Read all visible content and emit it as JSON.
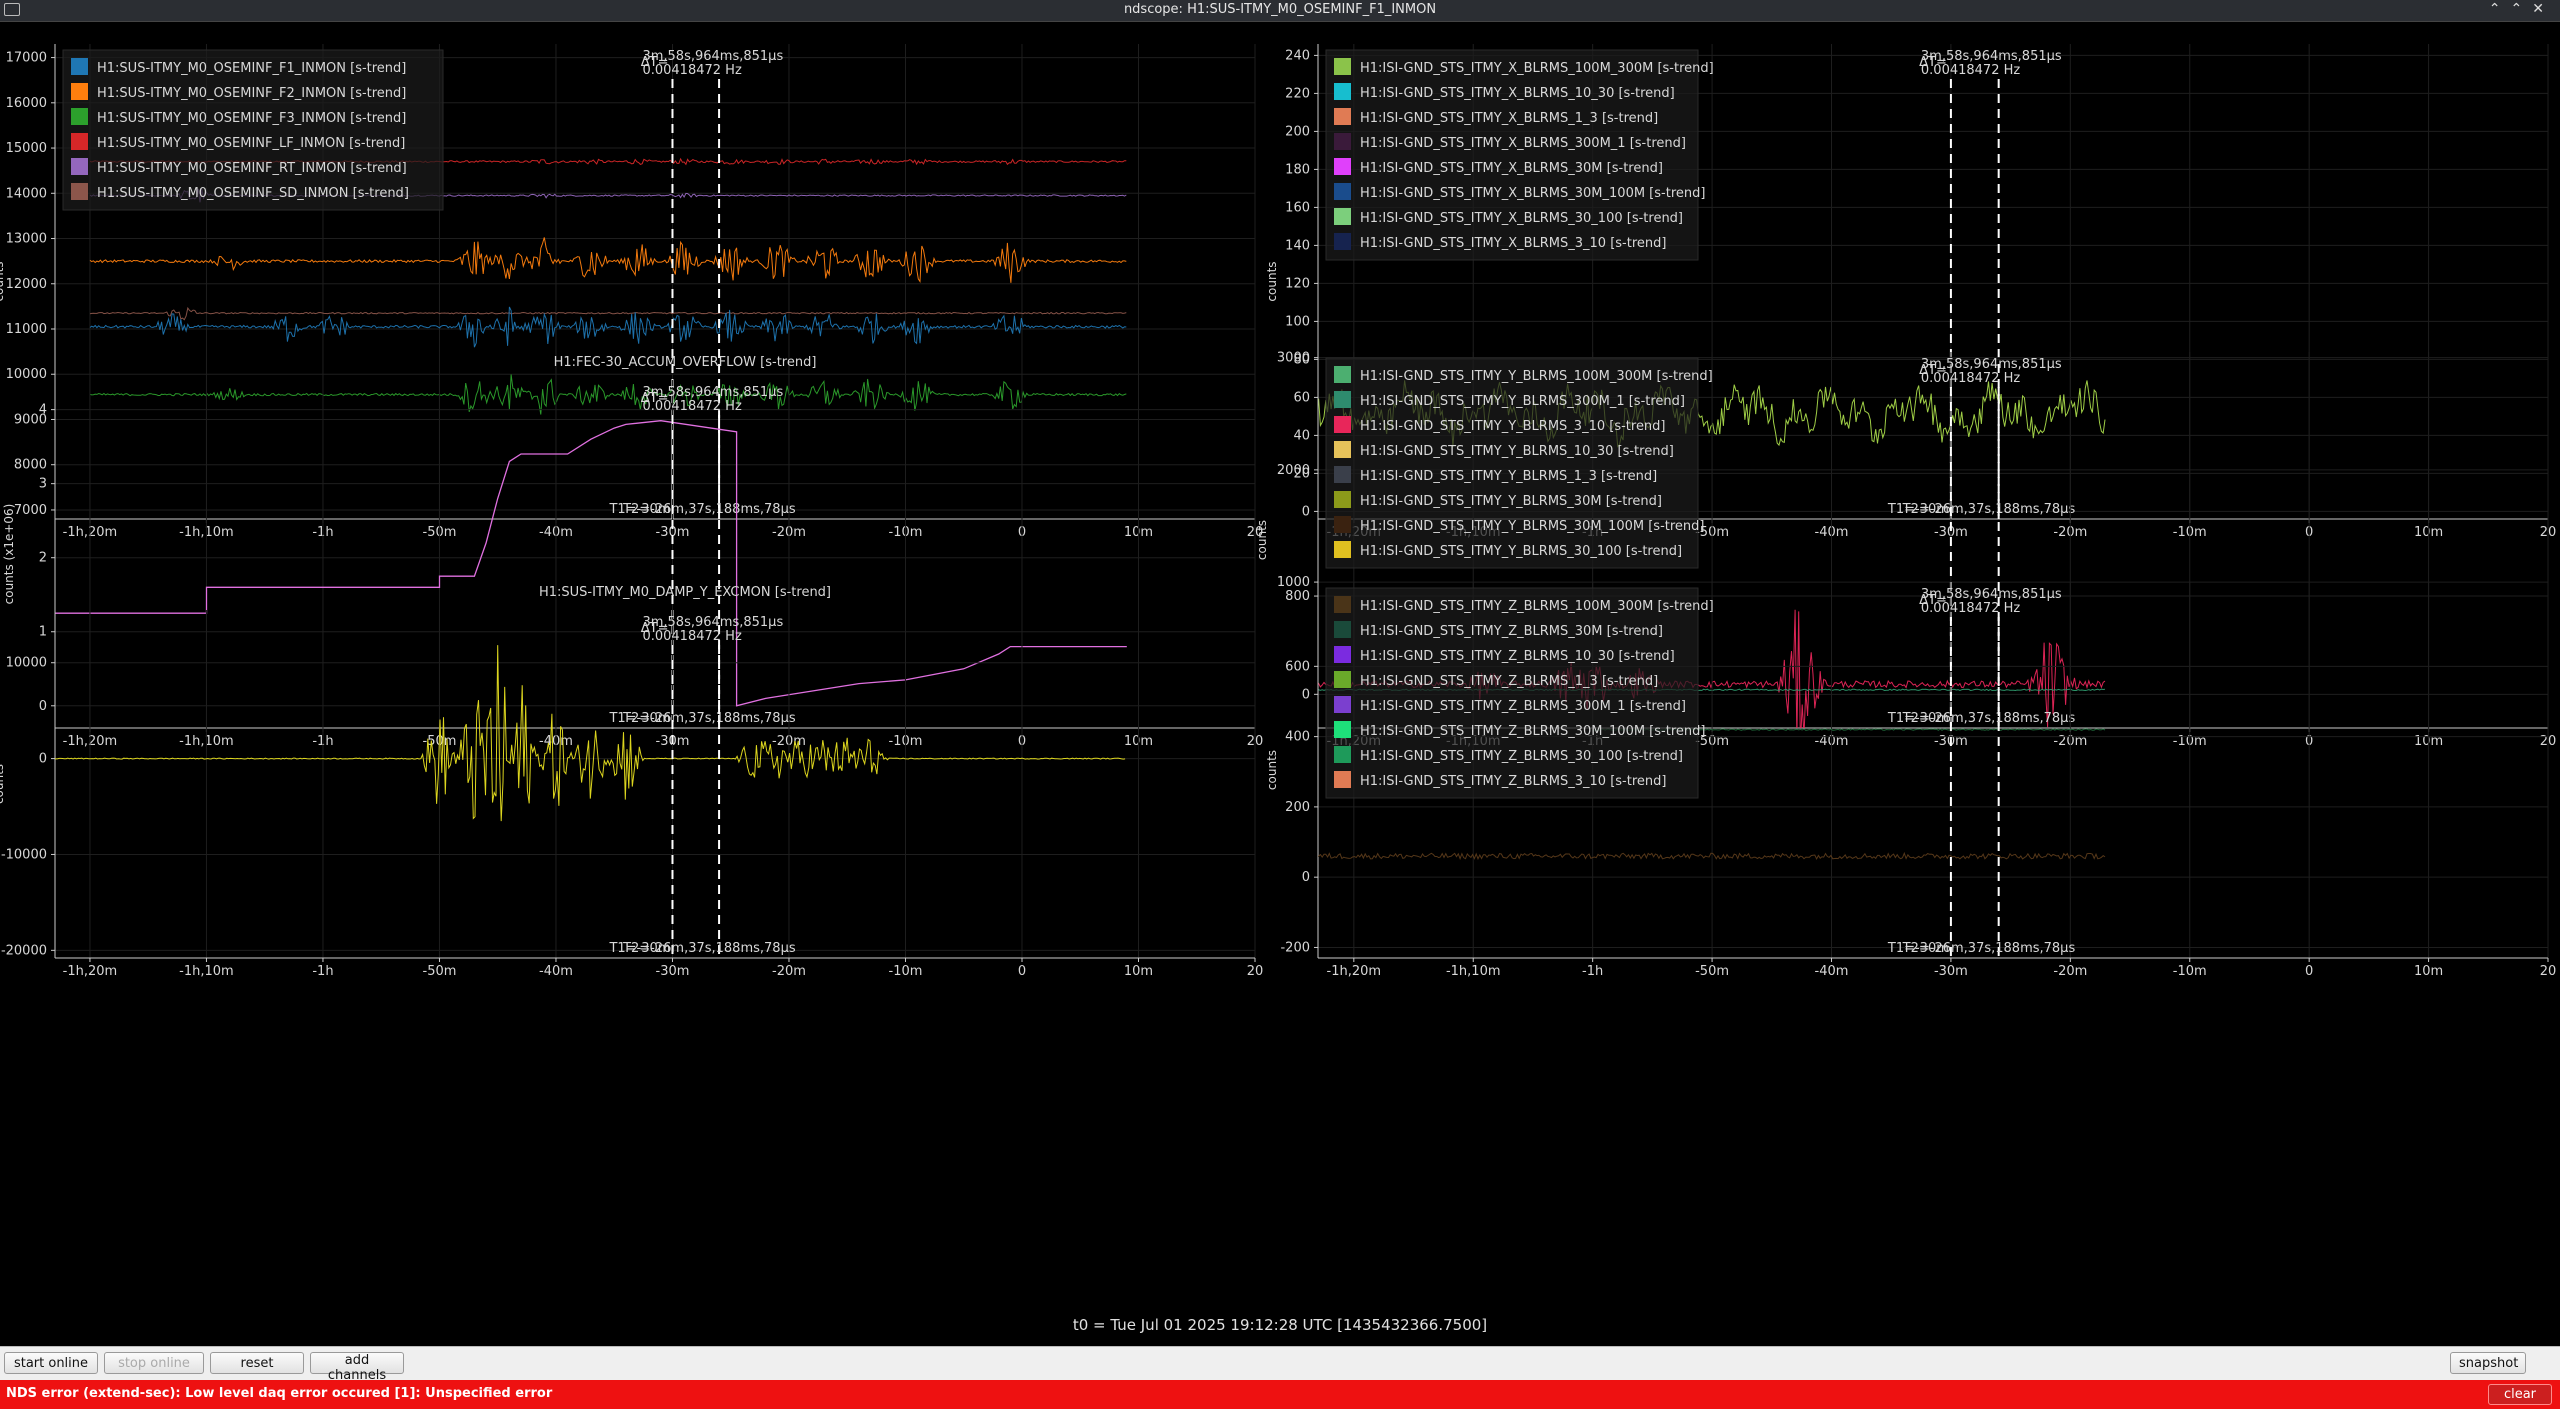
{
  "window": {
    "title": "ndscope: H1:SUS-ITMY_M0_OSEMINF_F1_INMON"
  },
  "plots": [
    {
      "id": "p1",
      "title": "",
      "ylabel": "counts",
      "yticks": [
        "17000",
        "16000",
        "15000",
        "14000",
        "13000",
        "12000",
        "11000",
        "10000",
        "9000",
        "8000",
        "7000"
      ],
      "ytick_values": [
        17000,
        16000,
        15000,
        14000,
        13000,
        12000,
        11000,
        10000,
        9000,
        8000,
        7000
      ],
      "ylim": [
        6800,
        17300
      ],
      "legend": [
        {
          "label": "H1:SUS-ITMY_M0_OSEMINF_F1_INMON [s-trend]",
          "color": "#1f77b4"
        },
        {
          "label": "H1:SUS-ITMY_M0_OSEMINF_F2_INMON [s-trend]",
          "color": "#ff7f0e"
        },
        {
          "label": "H1:SUS-ITMY_M0_OSEMINF_F3_INMON [s-trend]",
          "color": "#2ca02c"
        },
        {
          "label": "H1:SUS-ITMY_M0_OSEMINF_LF_INMON [s-trend]",
          "color": "#d62728"
        },
        {
          "label": "H1:SUS-ITMY_M0_OSEMINF_RT_INMON [s-trend]",
          "color": "#9467bd"
        },
        {
          "label": "H1:SUS-ITMY_M0_OSEMINF_SD_INMON [s-trend]",
          "color": "#8c564b"
        }
      ],
      "series": [
        {
          "color": "#d62728",
          "base": 14700,
          "noise": 20,
          "bursts": [
            [
              -41,
              50
            ],
            [
              -37,
              50
            ],
            [
              -33,
              50
            ],
            [
              -29,
              50
            ],
            [
              -25,
              50
            ],
            [
              -21,
              50
            ],
            [
              -17,
              50
            ],
            [
              -13,
              50
            ],
            [
              -9,
              50
            ],
            [
              -1,
              50
            ]
          ],
          "start": -80,
          "end": 9
        },
        {
          "color": "#9467bd",
          "base": 13950,
          "noise": 15,
          "bursts": [
            [
              -71,
              250
            ],
            [
              -41,
              40
            ],
            [
              -29,
              40
            ]
          ],
          "start": -80,
          "end": 9
        },
        {
          "color": "#ff7f0e",
          "base": 12500,
          "noise": 30,
          "bursts": [
            [
              -68,
              200
            ],
            [
              -47,
              500
            ],
            [
              -44,
              450
            ],
            [
              -41,
              500
            ],
            [
              -37,
              500
            ],
            [
              -33,
              500
            ],
            [
              -29,
              500
            ],
            [
              -25,
              500
            ],
            [
              -21,
              500
            ],
            [
              -17,
              500
            ],
            [
              -13,
              500
            ],
            [
              -9,
              500
            ],
            [
              -1,
              500
            ]
          ],
          "start": -80,
          "end": 9
        },
        {
          "color": "#8c564b",
          "base": 11350,
          "noise": 15,
          "bursts": [
            [
              -72,
              200
            ]
          ],
          "start": -80,
          "end": 9
        },
        {
          "color": "#1f77b4",
          "base": 11050,
          "noise": 30,
          "bursts": [
            [
              -73,
              300
            ],
            [
              -63,
              350
            ],
            [
              -59,
              350
            ],
            [
              -47,
              500
            ],
            [
              -44,
              450
            ],
            [
              -41,
              450
            ],
            [
              -37,
              400
            ],
            [
              -33,
              400
            ],
            [
              -29,
              400
            ],
            [
              -25,
              400
            ],
            [
              -21,
              400
            ],
            [
              -17,
              400
            ],
            [
              -13,
              400
            ],
            [
              -9,
              400
            ],
            [
              -1,
              400
            ]
          ],
          "start": -80,
          "end": 9
        },
        {
          "color": "#2ca02c",
          "base": 9550,
          "noise": 25,
          "bursts": [
            [
              -68,
              150
            ],
            [
              -47,
              500
            ],
            [
              -44,
              500
            ],
            [
              -41,
              550
            ],
            [
              -37,
              400
            ],
            [
              -33,
              400
            ],
            [
              -29,
              400
            ],
            [
              -25,
              400
            ],
            [
              -21,
              400
            ],
            [
              -17,
              400
            ],
            [
              -13,
              400
            ],
            [
              -9,
              400
            ],
            [
              -1,
              400
            ]
          ],
          "start": -80,
          "end": 9
        }
      ]
    },
    {
      "id": "p2",
      "title": "",
      "ylabel": "counts",
      "yticks": [
        "240",
        "220",
        "200",
        "180",
        "160",
        "140",
        "120",
        "100",
        "80",
        "60",
        "40",
        "20",
        "0"
      ],
      "ytick_values": [
        240,
        220,
        200,
        180,
        160,
        140,
        120,
        100,
        80,
        60,
        40,
        20,
        0
      ],
      "ylim": [
        -4,
        246
      ],
      "legend": [
        {
          "label": "H1:ISI-GND_STS_ITMY_X_BLRMS_100M_300M [s-trend]",
          "color": "#8bc34a"
        },
        {
          "label": "H1:ISI-GND_STS_ITMY_X_BLRMS_10_30 [s-trend]",
          "color": "#17becf"
        },
        {
          "label": "H1:ISI-GND_STS_ITMY_X_BLRMS_1_3 [s-trend]",
          "color": "#e07b54"
        },
        {
          "label": "H1:ISI-GND_STS_ITMY_X_BLRMS_300M_1 [s-trend]",
          "color": "#3a1a3a"
        },
        {
          "label": "H1:ISI-GND_STS_ITMY_X_BLRMS_30M [s-trend]",
          "color": "#e040fb"
        },
        {
          "label": "H1:ISI-GND_STS_ITMY_X_BLRMS_30M_100M [s-trend]",
          "color": "#1a4c8c"
        },
        {
          "label": "H1:ISI-GND_STS_ITMY_X_BLRMS_30_100 [s-trend]",
          "color": "#7ccf7c"
        },
        {
          "label": "H1:ISI-GND_STS_ITMY_X_BLRMS_3_10 [s-trend]",
          "color": "#16234f"
        }
      ],
      "series": [
        {
          "color": "#a8d94a",
          "base": 52,
          "noise": 8,
          "bursts": [],
          "start": -84,
          "end": -17
        }
      ]
    },
    {
      "id": "p3",
      "title": "H1:FEC-30_ACCUM_OVERFLOW [s-trend]",
      "ylabel": "counts (x1e+06)",
      "yticks": [
        "4",
        "3",
        "2",
        "1",
        "0"
      ],
      "ytick_values": [
        4,
        3,
        2,
        1,
        0
      ],
      "ylim": [
        -0.3,
        4.4
      ],
      "legend": [],
      "steps": {
        "color": "#e070e0",
        "points": [
          [
            -84,
            1.25
          ],
          [
            -70,
            1.25
          ],
          [
            -70,
            1.6
          ],
          [
            -50,
            1.6
          ],
          [
            -50,
            1.75
          ],
          [
            -47,
            1.75
          ],
          [
            -46,
            2.2
          ],
          [
            -45,
            2.8
          ],
          [
            -44,
            3.3
          ],
          [
            -43,
            3.4
          ],
          [
            -39,
            3.4
          ],
          [
            -37,
            3.6
          ],
          [
            -35,
            3.75
          ],
          [
            -34,
            3.8
          ],
          [
            -31,
            3.85
          ],
          [
            -24.5,
            3.7
          ],
          [
            -24.5,
            0
          ],
          [
            -22,
            0.1
          ],
          [
            -18,
            0.2
          ],
          [
            -14,
            0.3
          ],
          [
            -10,
            0.35
          ],
          [
            -5,
            0.5
          ],
          [
            -2,
            0.7
          ],
          [
            -1,
            0.8
          ],
          [
            9,
            0.8
          ]
        ]
      }
    },
    {
      "id": "p4",
      "title": "",
      "ylabel": "counts",
      "yticks": [
        "3000",
        "2000",
        "1000",
        "0"
      ],
      "ytick_values": [
        3000,
        2000,
        1000,
        0
      ],
      "ylim": [
        -300,
        3050
      ],
      "legend": [
        {
          "label": "H1:ISI-GND_STS_ITMY_Y_BLRMS_100M_300M [s-trend]",
          "color": "#4caf70"
        },
        {
          "label": "H1:ISI-GND_STS_ITMY_Y_BLRMS_300M_1 [s-trend]",
          "color": "#2e8b6e"
        },
        {
          "label": "H1:ISI-GND_STS_ITMY_Y_BLRMS_3_10 [s-trend]",
          "color": "#e8265a"
        },
        {
          "label": "H1:ISI-GND_STS_ITMY_Y_BLRMS_10_30 [s-trend]",
          "color": "#e6c25a"
        },
        {
          "label": "H1:ISI-GND_STS_ITMY_Y_BLRMS_1_3 [s-trend]",
          "color": "#3a3f4a"
        },
        {
          "label": "H1:ISI-GND_STS_ITMY_Y_BLRMS_30M [s-trend]",
          "color": "#8c9a1a"
        },
        {
          "label": "H1:ISI-GND_STS_ITMY_Y_BLRMS_30M_100M [s-trend]",
          "color": "#3a2210"
        },
        {
          "label": "H1:ISI-GND_STS_ITMY_Y_BLRMS_30_100 [s-trend]",
          "color": "#e0c020"
        }
      ],
      "series": [
        {
          "color": "#e8265a",
          "base": 90,
          "noise": 30,
          "bursts": [
            [
              -69,
              150
            ],
            [
              -62,
              250
            ],
            [
              -60,
              300
            ],
            [
              -56,
              150
            ],
            [
              -43,
              550
            ],
            [
              -42,
              300
            ],
            [
              -22,
              350
            ],
            [
              -21,
              250
            ]
          ],
          "start": -84,
          "end": -17
        },
        {
          "color": "#2e9a6e",
          "base": 40,
          "noise": 6,
          "bursts": [],
          "start": -84,
          "end": -17
        }
      ]
    },
    {
      "id": "p5",
      "title": "H1:SUS-ITMY_M0_DAMP_Y_EXCMON [s-trend]",
      "ylabel": "counts",
      "yticks": [
        "10000",
        "0",
        "-10000",
        "-20000"
      ],
      "ytick_values": [
        10000,
        0,
        -10000,
        -20000
      ],
      "ylim": [
        -20800,
        15500
      ],
      "legend": [],
      "series": [
        {
          "color": "#e8e020",
          "base": 0,
          "noise": 50,
          "bursts": [
            [
              -50,
              6000
            ],
            [
              -47,
              8000
            ],
            [
              -45,
              12000
            ],
            [
              -43,
              9000
            ],
            [
              -40,
              6000
            ],
            [
              -37,
              5000
            ],
            [
              -34,
              5000
            ],
            [
              -23,
              2500
            ],
            [
              -21,
              2500
            ],
            [
              -19,
              2500
            ],
            [
              -17,
              2500
            ],
            [
              -15,
              2500
            ],
            [
              -13,
              2500
            ]
          ],
          "start": -84,
          "end": 9
        }
      ]
    },
    {
      "id": "p6",
      "title": "",
      "ylabel": "counts",
      "yticks": [
        "800",
        "600",
        "400",
        "200",
        "0",
        "-200"
      ],
      "ytick_values": [
        800,
        600,
        400,
        200,
        0,
        -200
      ],
      "ylim": [
        -230,
        840
      ],
      "legend": [
        {
          "label": "H1:ISI-GND_STS_ITMY_Z_BLRMS_100M_300M [s-trend]",
          "color": "#4a3418"
        },
        {
          "label": "H1:ISI-GND_STS_ITMY_Z_BLRMS_30M [s-trend]",
          "color": "#1a4a3a"
        },
        {
          "label": "H1:ISI-GND_STS_ITMY_Z_BLRMS_10_30 [s-trend]",
          "color": "#7b2be0"
        },
        {
          "label": "H1:ISI-GND_STS_ITMY_Z_BLRMS_1_3 [s-trend]",
          "color": "#6aaa2a"
        },
        {
          "label": "H1:ISI-GND_STS_ITMY_Z_BLRMS_300M_1 [s-trend]",
          "color": "#7b3fcf"
        },
        {
          "label": "H1:ISI-GND_STS_ITMY_Z_BLRMS_30M_100M [s-trend]",
          "color": "#1ee07a"
        },
        {
          "label": "H1:ISI-GND_STS_ITMY_Z_BLRMS_30_100 [s-trend]",
          "color": "#1e9a5a"
        },
        {
          "label": "H1:ISI-GND_STS_ITMY_Z_BLRMS_3_10 [s-trend]",
          "color": "#e07b54"
        }
      ],
      "series": [
        {
          "color": "#1f6a3a",
          "base": 420,
          "noise": 2,
          "bursts": [],
          "start": -60,
          "end": -17
        },
        {
          "color": "#5a3a1a",
          "base": 60,
          "noise": 8,
          "bursts": [],
          "start": -84,
          "end": -17
        }
      ]
    }
  ],
  "xaxis": {
    "tick_values": [
      -80,
      -70,
      -60,
      -50,
      -40,
      -30,
      -20,
      -10,
      0,
      10,
      20
    ],
    "tick_labels": [
      "-1h,20m",
      "-1h,10m",
      "-1h",
      "-50m",
      "-40m",
      "-30m",
      "-20m",
      "-10m",
      "0",
      "10m",
      "20"
    ],
    "xlim": [
      -83,
      20
    ]
  },
  "cursors": {
    "t1": -30,
    "t2": -26,
    "delta_label": "ΔT=",
    "delta_value": "3m,58s,964ms,851μs",
    "freq_value": "0.00418472 Hz",
    "t1_label": "T1=-30m",
    "t2_label": "T2=-26m,37s,188ms,78μs"
  },
  "t0": "t0 = Tue Jul 01 2025 19:12:28 UTC [1435432366.7500]",
  "toolbar": {
    "start_online": "start online",
    "stop_online": "stop online",
    "reset": "reset",
    "add_channels": "add channels",
    "snapshot": "snapshot"
  },
  "status": {
    "message": "NDS error (extend-sec): Low level daq error occured [1]: Unspecified error",
    "clear": "clear"
  },
  "colors": {
    "background": "#000000",
    "axis": "#cccccc",
    "grid": "#1e1e1e",
    "status_bg": "#ee1111"
  }
}
